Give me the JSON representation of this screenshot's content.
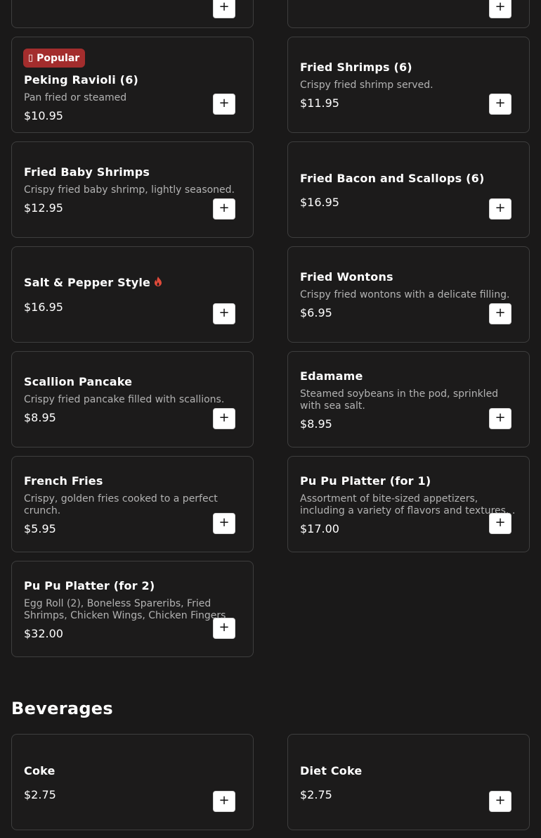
{
  "items": {
    "peking_ravioli": {
      "badge": "Popular",
      "badge_icon": "▯",
      "name": "Peking Ravioli (6)",
      "desc": "Pan fried or steamed",
      "price": "$10.95"
    },
    "fried_shrimps": {
      "name": "Fried Shrimps (6)",
      "desc": "Crispy fried shrimp served.",
      "price": "$11.95"
    },
    "fried_baby_shrimps": {
      "name": "Fried Baby Shrimps",
      "desc": "Crispy fried baby shrimp, lightly seasoned.",
      "price": "$12.95"
    },
    "fried_bacon_scallops": {
      "name": "Fried Bacon and Scallops (6)",
      "price": "$16.95"
    },
    "salt_pepper_style": {
      "name": "Salt & Pepper Style",
      "price": "$16.95",
      "spicy_icon": "flame-icon"
    },
    "fried_wontons": {
      "name": "Fried Wontons",
      "desc": "Crispy fried wontons with a delicate filling.",
      "price": "$6.95"
    },
    "scallion_pancake": {
      "name": "Scallion Pancake",
      "desc": "Crispy fried pancake filled with scallions.",
      "price": "$8.95"
    },
    "edamame": {
      "name": "Edamame",
      "desc": "Steamed soybeans in the pod, sprinkled with sea salt.",
      "price": "$8.95"
    },
    "french_fries": {
      "name": "French Fries",
      "desc": "Crispy, golden fries cooked to a perfect crunch.",
      "price": "$5.95"
    },
    "pu_pu_1": {
      "name": "Pu Pu Platter (for 1)",
      "desc": "Assortment of bite-sized appetizers, including a variety of flavors and textures. .",
      "price": "$17.00"
    },
    "pu_pu_2": {
      "name": "Pu Pu Platter (for 2)",
      "desc": "Egg Roll (2), Boneless Spareribs, Fried Shrimps, Chicken Wings, Chicken Fingers",
      "price": "$32.00"
    },
    "coke": {
      "name": "Coke",
      "price": "$2.75"
    },
    "diet_coke": {
      "name": "Diet Coke",
      "price": "$2.75"
    }
  },
  "sections": {
    "beverages": "Beverages"
  },
  "add_label": "+",
  "colors": {
    "background": "#1a1919",
    "card_border": "#3e3e3e",
    "badge": "#a32d2d",
    "spicy": "#e04a3a"
  }
}
